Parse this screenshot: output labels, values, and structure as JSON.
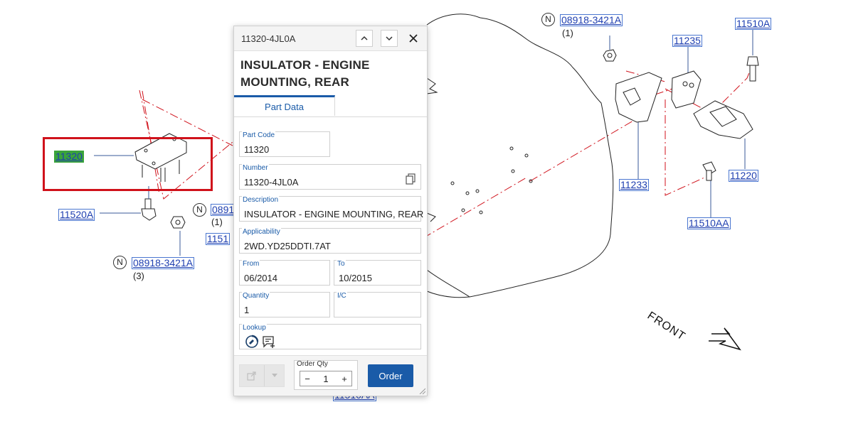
{
  "diagram": {
    "callouts": {
      "c11320": "11320",
      "c11520A": "11520A",
      "c0891_partial": "0891",
      "c1151_partial": "1151",
      "c08918_left": "08918-3421A",
      "c08918_top": "08918-3421A",
      "c11235": "11235",
      "c11510A": "11510A",
      "c11233": "11233",
      "c11220": "11220",
      "c11510AA": "11510AA",
      "c_bottom_partial": "11510AA"
    },
    "quantities": {
      "q_left1": "(1)",
      "q_left3": "(3)",
      "q_top1": "(1)"
    },
    "n_symbol": "N",
    "front_label": "FRONT"
  },
  "panel": {
    "header_id": "11320-4JL0A",
    "title": "INSULATOR - ENGINE MOUNTING, REAR",
    "tab_label": "Part Data",
    "fields": {
      "part_code": {
        "label": "Part Code",
        "value": "11320"
      },
      "number": {
        "label": "Number",
        "value": "11320-4JL0A"
      },
      "description": {
        "label": "Description",
        "value": "INSULATOR - ENGINE MOUNTING, REAR"
      },
      "applicability": {
        "label": "Applicability",
        "value": "2WD.YD25DDTI.7AT"
      },
      "from": {
        "label": "From",
        "value": "06/2014"
      },
      "to": {
        "label": "To",
        "value": "10/2015"
      },
      "quantity": {
        "label": "Quantity",
        "value": "1"
      },
      "ic": {
        "label": "I/C",
        "value": ""
      },
      "lookup": {
        "label": "Lookup"
      }
    },
    "footer": {
      "order_qty_label": "Order Qty",
      "order_qty_value": "1",
      "minus": "−",
      "plus": "+",
      "order_button": "Order"
    }
  },
  "colors": {
    "accent": "#1a5ba8",
    "highlight_box": "#d0121b",
    "callout_highlight": "#3aa43a",
    "callout_text": "#1f3fb0"
  }
}
